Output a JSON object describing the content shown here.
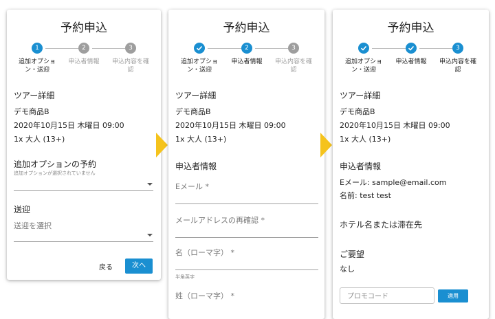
{
  "form_title": "予約申込",
  "steps": {
    "addon": "追加オプショ\nン・送迎",
    "applicant": "申込者情報",
    "confirm": "申込内容を確\n認",
    "numbers": [
      "1",
      "2",
      "3"
    ]
  },
  "tour": {
    "heading": "ツアー詳細",
    "product": "デモ商品B",
    "datetime": "2020年10月15日 木曜日 09:00",
    "guests": "1x 大人 (13+)"
  },
  "screen1": {
    "addon_heading": "追加オプションの予約",
    "addon_note": "追加オプションが選択されていません",
    "transfer_heading": "送迎",
    "transfer_placeholder": "送迎を選択",
    "back_label": "戻る",
    "next_label": "次へ"
  },
  "screen2": {
    "section_heading": "申込者情報",
    "email_label": "Eメール *",
    "email_confirm_label": "メールアドレスの再確認 *",
    "first_name_label": "名（ローマ字） *",
    "first_name_hint": "半角英字",
    "last_name_label": "姓（ローマ字） *"
  },
  "screen3": {
    "section_heading": "申込者情報",
    "email_line": "Eメール: sample@email.com",
    "name_line": "名前: test test",
    "hotel_heading": "ホテル名または滞在先",
    "requests_heading": "ご要望",
    "requests_value": "なし",
    "promo_placeholder": "プロモコード",
    "apply_label": "適用"
  },
  "colors": {
    "accent": "#1a8fd1",
    "inactive": "#9e9e9e",
    "arrow": "#f5c31c"
  },
  "icons": {
    "done": "check-icon",
    "dropdown": "caret-down-icon"
  }
}
